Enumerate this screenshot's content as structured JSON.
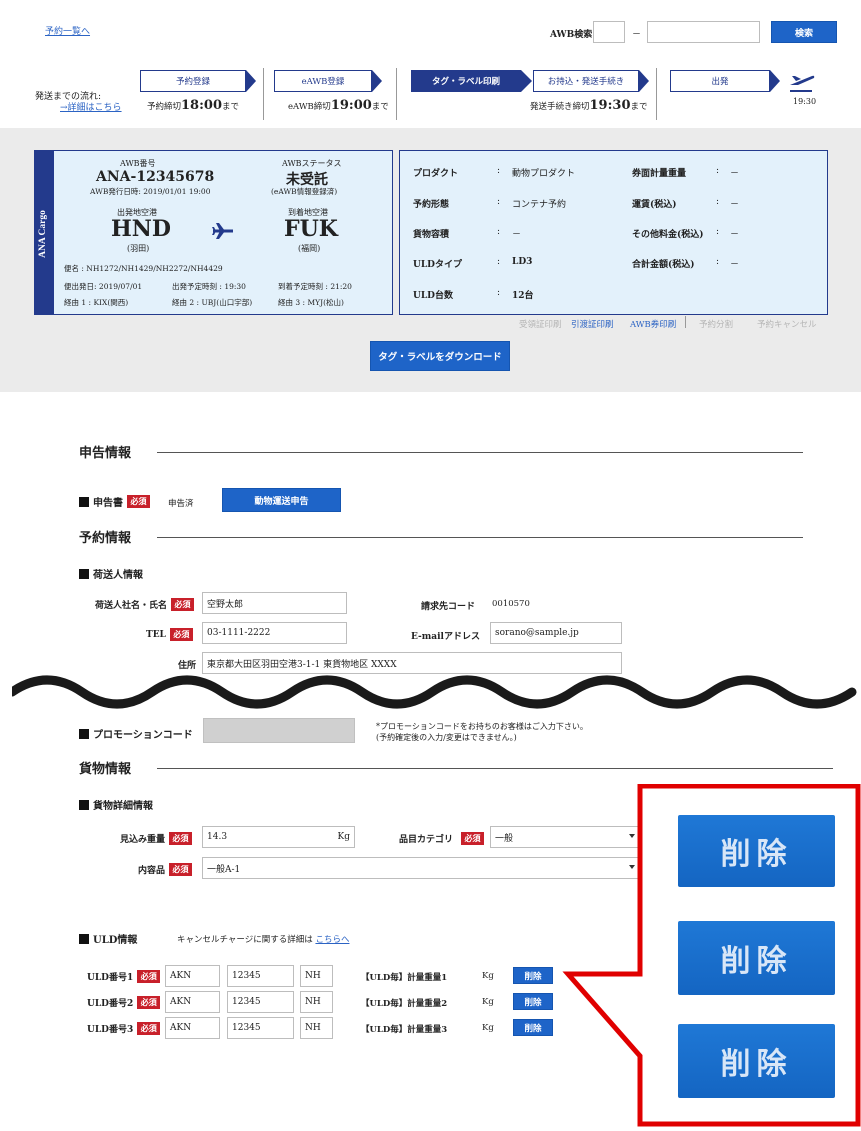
{
  "top": {
    "back_link": "予約一覧へ",
    "awb_search_label": "AWB検索",
    "dash": "－",
    "search_button": "検索"
  },
  "flow": {
    "label": "発送までの流れ:",
    "detail_link": "→詳細はこちら",
    "steps": [
      {
        "label": "予約登録",
        "active": false
      },
      {
        "label": "eAWB登録",
        "active": false
      },
      {
        "label": "タグ・ラベル印刷",
        "active": true
      },
      {
        "label": "お持込・発送手続き",
        "active": false
      },
      {
        "label": "出発",
        "active": false
      }
    ],
    "deadline1_pre": "予約締切",
    "deadline1_time": "18:00",
    "deadline1_post": "まで",
    "deadline2_pre": "eAWB締切",
    "deadline2_time": "19:00",
    "deadline2_post": "まで",
    "deadline3_pre": "発送手続き締切",
    "deadline3_time": "19:30",
    "deadline3_post": "まで",
    "depart_time": "19:30"
  },
  "card": {
    "brand": "ANA Cargo",
    "awb_no_label": "AWB番号",
    "awb_no": "ANA-12345678",
    "issue_label": "AWB発行日時:",
    "issue_value": "2019/01/01 19:00",
    "status_label": "AWBステータス",
    "status_value": "未受託",
    "status_sub": "(eAWB情報登録済)",
    "origin_label": "出発地空港",
    "origin_code": "HND",
    "origin_name": "(羽田)",
    "dest_label": "到着地空港",
    "dest_code": "FUK",
    "dest_name": "(福岡)",
    "flight_label": "便名",
    "flight_value": ": NH1272/NH1429/NH2272/NH4429",
    "dep_date_label": "便出発日:",
    "dep_date_value": "2019/07/01",
    "dep_time_label": "出発予定時刻 :",
    "dep_time_value": "19:30",
    "arr_time_label": "到着予定時刻 :",
    "arr_time_value": "21:20",
    "via1": "経由 1 : KIX(関西)",
    "via2": "経由 2 : UBJ(山口宇部)",
    "via3": "経由 3 : MYJ(松山)"
  },
  "details": {
    "rows_left": [
      {
        "label": "プロダクト",
        "value": "動物プロダクト"
      },
      {
        "label": "予約形態",
        "value": "コンテナ予約"
      },
      {
        "label": "貨物容積",
        "value": "－"
      },
      {
        "label": "ULDタイプ",
        "value": "LD3"
      },
      {
        "label": "ULD台数",
        "value": "12台"
      }
    ],
    "rows_right": [
      {
        "label": "券面計量重量",
        "value": "－"
      },
      {
        "label": "運賃(税込)",
        "value": "－"
      },
      {
        "label": "その他料金(税込)",
        "value": "－"
      },
      {
        "label": "合計金額(税込)",
        "value": "－"
      }
    ],
    "colon": ":"
  },
  "actions": {
    "receipt": "受領証印刷",
    "handover": "引渡証印刷",
    "awb_print": "AWB券印刷",
    "split": "予約分割",
    "cancel": "予約キャンセル",
    "download_button": "タグ・ラベルをダウンロード"
  },
  "declaration": {
    "section_title": "申告情報",
    "doc_label": "申告書",
    "required": "必須",
    "status": "申告済",
    "button": "動物運送申告"
  },
  "reservation": {
    "section_title": "予約情報",
    "shipper_title": "荷送人情報",
    "name_label": "荷送人社名・氏名",
    "name_value": "空野太郎",
    "billing_label": "請求先コード",
    "billing_value": "0010570",
    "tel_label": "TEL",
    "tel_value": "03-1111-2222",
    "email_label": "E-mailアドレス",
    "email_value": "sorano@sample.jp",
    "address_label": "住所",
    "address_value": "東京都大田区羽田空港3-1-1 東貨物地区 XXXX"
  },
  "promo": {
    "label": "プロモーションコード",
    "note1": "*プロモーションコードをお持ちのお客様はご入力下さい。",
    "note2": "(予約確定後の入力/変更はできません。)"
  },
  "cargo": {
    "section_title": "貨物情報",
    "detail_title": "貨物詳細情報",
    "weight_label": "見込み重量",
    "weight_value": "14.3",
    "weight_unit": "Kg",
    "category_label": "品目カテゴリ",
    "category_value": "一般",
    "content_label": "内容品",
    "content_value": "一般A-1"
  },
  "uld": {
    "title": "ULD情報",
    "cancel_note": "キャンセルチャージに関する詳細は",
    "cancel_link": "こちらへ",
    "rows": [
      {
        "label": "ULD番号1",
        "type": "AKN",
        "serial": "12345",
        "owner": "NH",
        "weight_label": "【ULD毎】計量重量1",
        "unit": "Kg",
        "delete": "削除"
      },
      {
        "label": "ULD番号2",
        "type": "AKN",
        "serial": "12345",
        "owner": "NH",
        "weight_label": "【ULD毎】計量重量2",
        "unit": "Kg",
        "delete": "削除"
      },
      {
        "label": "ULD番号3",
        "type": "AKN",
        "serial": "12345",
        "owner": "NH",
        "weight_label": "【ULD毎】計量重量3",
        "unit": "Kg",
        "delete": "削除"
      }
    ]
  },
  "zoom": {
    "delete_labels": [
      "削除",
      "削除",
      "削除"
    ]
  },
  "colors": {
    "accent": "#1e64c8",
    "navy": "#233a8c",
    "required": "#c8202a",
    "callout": "#e00000",
    "card_bg": "#e3f1fb"
  }
}
